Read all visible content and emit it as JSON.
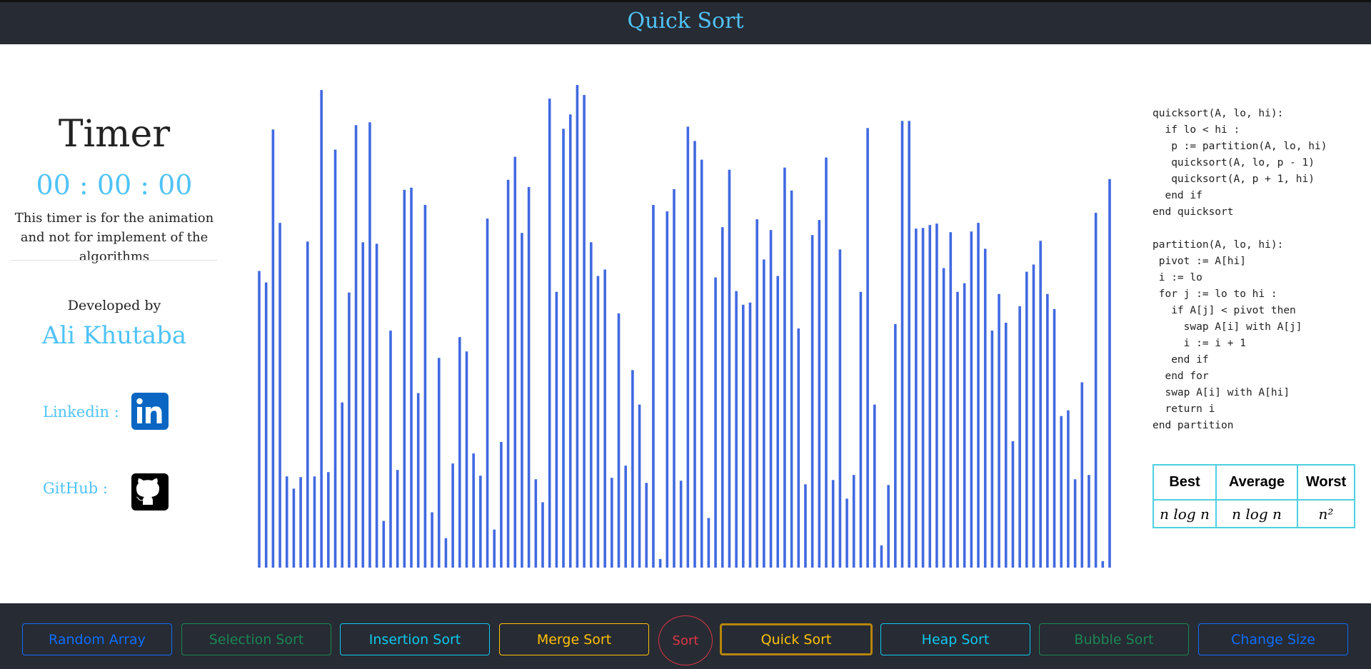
{
  "header": {
    "title": "Quick Sort"
  },
  "timer": {
    "title": "Timer",
    "value": "00 : 00 : 00",
    "note": "This timer is for the animation and not for implement of the algorithms"
  },
  "developer": {
    "label": "Developed by",
    "name": "Ali Khutaba",
    "linkedin_label": "Linkedin :",
    "github_label": "GitHub :"
  },
  "pseudo_code": "quicksort(A, lo, hi):\n  if lo < hi :\n   p := partition(A, lo, hi)\n   quicksort(A, lo, p - 1)\n   quicksort(A, p + 1, hi)\n  end if\nend quicksort\n\npartition(A, lo, hi):\n pivot := A[hi]\n i := lo\n for j := lo to hi :\n   if A[j] < pivot then\n     swap A[i] with A[j]\n     i := i + 1\n   end if\n  end for\n  swap A[i] with A[hi]\n  return i\nend partition",
  "complexity": {
    "headers": [
      "Best",
      "Average",
      "Worst"
    ],
    "values": [
      "n log n",
      "n log n",
      "n²"
    ]
  },
  "array": {
    "bar_color": "#4169e1",
    "max_value": 672,
    "values": [
      413,
      397,
      610,
      480,
      127,
      110,
      126,
      454,
      127,
      665,
      133,
      582,
      230,
      383,
      616,
      453,
      620,
      451,
      65,
      330,
      136,
      526,
      529,
      243,
      505,
      77,
      292,
      41,
      145,
      321,
      301,
      159,
      128,
      486,
      53,
      175,
      540,
      572,
      466,
      530,
      123,
      91,
      653,
      384,
      611,
      631,
      672,
      658,
      453,
      406,
      415,
      125,
      354,
      142,
      275,
      227,
      118,
      505,
      12,
      496,
      527,
      121,
      614,
      594,
      568,
      69,
      404,
      474,
      554,
      385,
      366,
      369,
      485,
      429,
      470,
      406,
      557,
      525,
      333,
      116,
      463,
      484,
      571,
      122,
      443,
      96,
      129,
      384,
      612,
      227,
      31,
      115,
      339,
      622,
      622,
      472,
      473,
      477,
      479,
      417,
      467,
      384,
      396,
      468,
      480,
      444,
      330,
      381,
      341,
      176,
      364,
      412,
      422,
      455,
      381,
      360,
      211,
      219,
      123,
      258,
      129,
      494,
      9,
      541
    ]
  },
  "footer": {
    "buttons": [
      {
        "label": "Random Array",
        "color": "#0d6efd"
      },
      {
        "label": "Selection Sort",
        "color": "#198754"
      },
      {
        "label": "Insertion Sort",
        "color": "#0dcaf0"
      },
      {
        "label": "Merge Sort",
        "color": "#ffc107"
      },
      {
        "label": "Sort",
        "color": "#dc3545"
      },
      {
        "label": "Quick Sort",
        "color": "#ffc107",
        "active": true
      },
      {
        "label": "Heap Sort",
        "color": "#0dcaf0"
      },
      {
        "label": "Bubble Sort",
        "color": "#198754"
      },
      {
        "label": "Change Size",
        "color": "#0d6efd"
      }
    ]
  }
}
